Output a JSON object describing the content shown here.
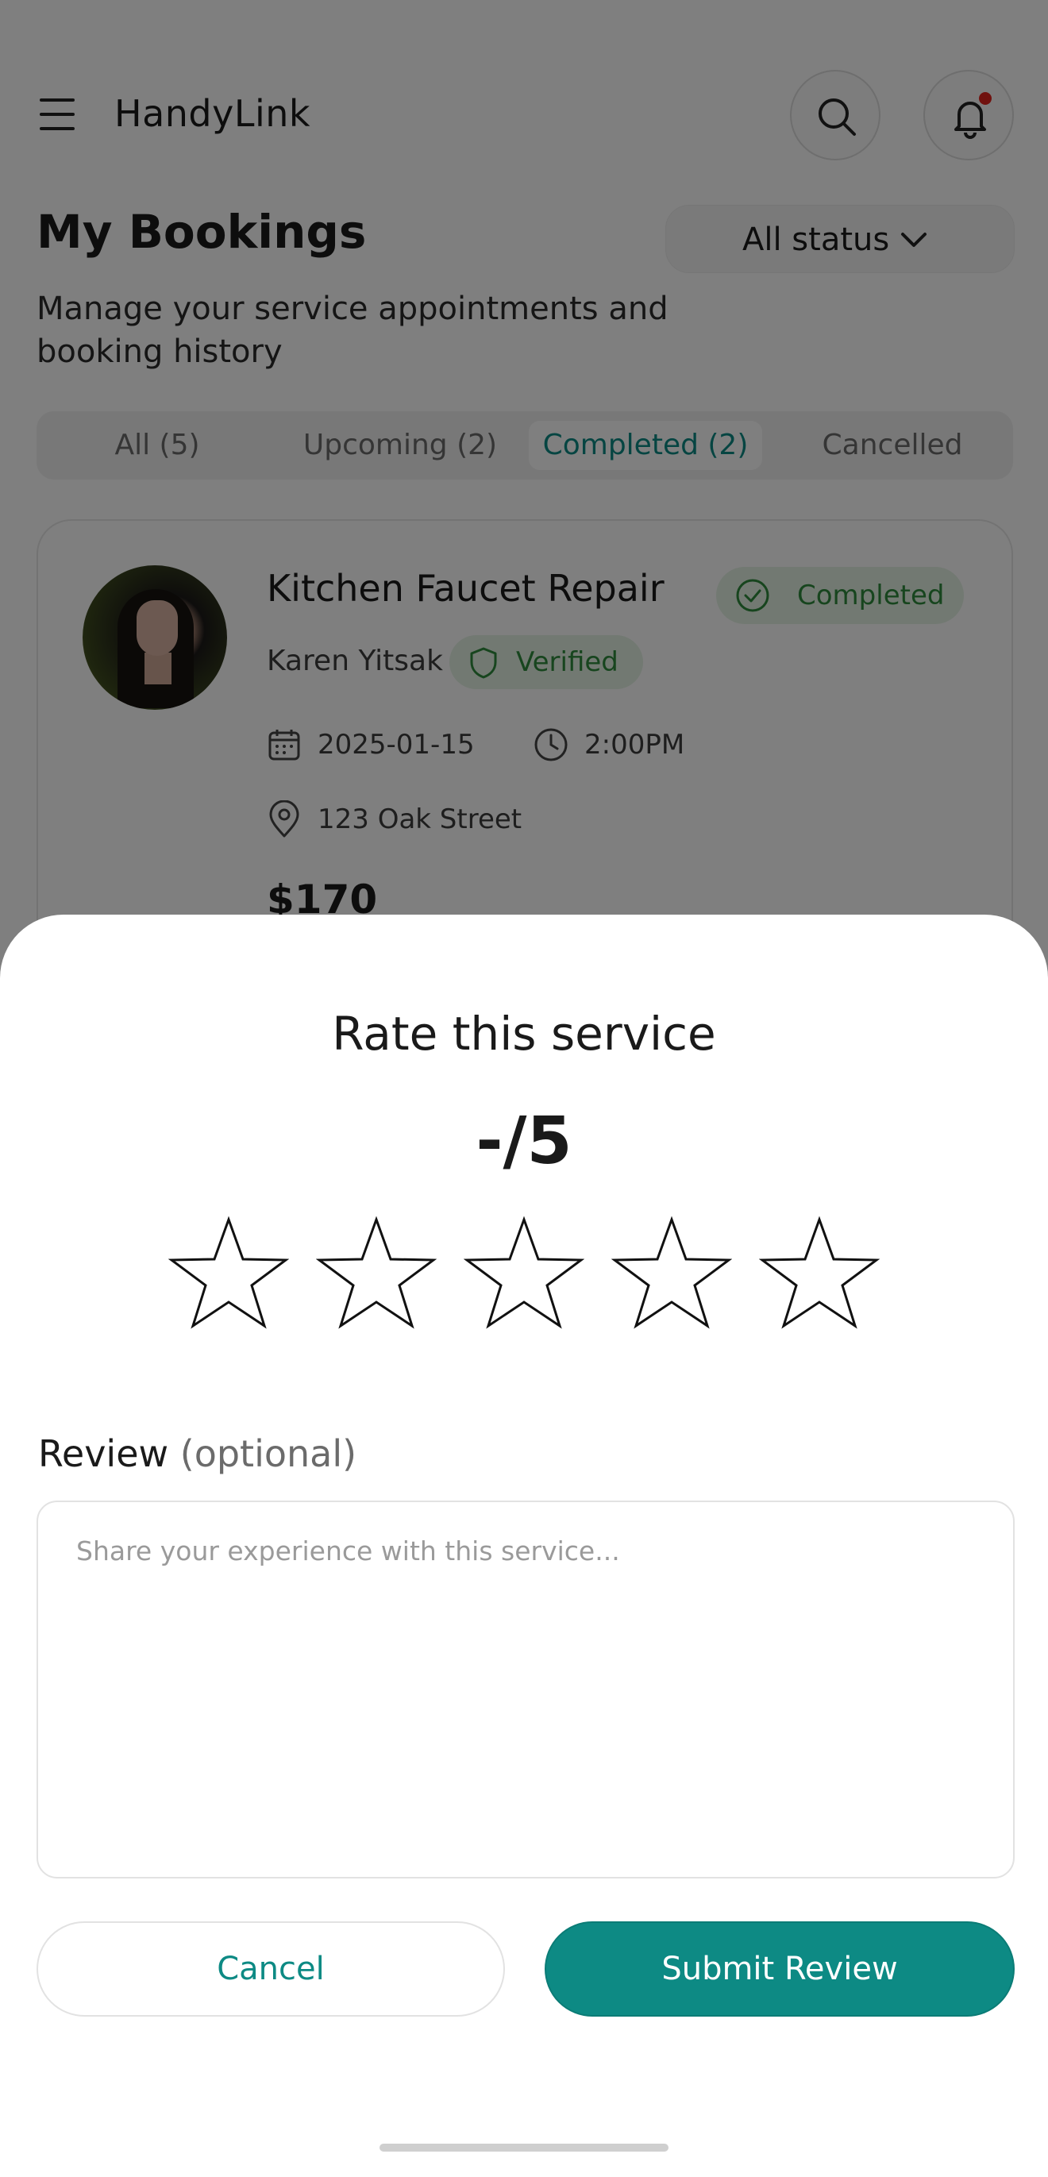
{
  "header": {
    "app_title": "HandyLink",
    "menu_icon": "hamburger-menu-icon",
    "search_icon": "search-icon",
    "bell_icon": "bell-icon",
    "has_notification": true
  },
  "page": {
    "title": "My Bookings",
    "status_filter": "All status",
    "subtitle_line1": "Manage your service appointments and",
    "subtitle_line2": "booking history"
  },
  "tabs": [
    {
      "label": "All (5)",
      "active": false
    },
    {
      "label": "Upcoming (2)",
      "active": false
    },
    {
      "label": "Completed (2)",
      "active": true
    },
    {
      "label": "Cancelled",
      "active": false
    }
  ],
  "booking": {
    "service": "Kitchen Faucet Repair",
    "status": "Completed",
    "provider": "Karen Yitsak",
    "provider_badge": "Verified",
    "date": "2025-01-15",
    "time": "2:00PM",
    "address": "123 Oak Street",
    "price": "$170"
  },
  "rating_sheet": {
    "title": "Rate this service",
    "rating_display": "-/5",
    "max_stars": 5,
    "selected_stars": 0,
    "review_label": "Review",
    "review_optional": "(optional)",
    "review_placeholder": "Share your experience with this service...",
    "review_value": "",
    "cancel_label": "Cancel",
    "submit_label": "Submit Review"
  },
  "colors": {
    "accent": "#0d8a84",
    "success": "#2f8a3d",
    "success_bg": "#e4f2e4",
    "notification": "#e0231c",
    "overlay": "rgba(0,0,0,0.5)"
  }
}
